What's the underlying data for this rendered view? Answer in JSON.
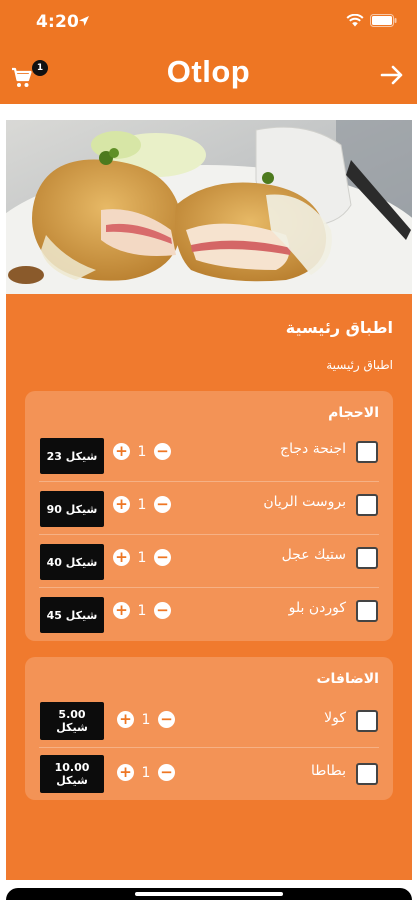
{
  "status_bar": {
    "time": "4:20"
  },
  "header": {
    "title": "Otlop",
    "cart_count": "1"
  },
  "hero": {
    "image": "cordon-bleu-chicken-photo"
  },
  "section": {
    "title": "اطباق رئيسية",
    "subtitle": "اطباق رئيسية"
  },
  "groups": [
    {
      "title": "الاحجام",
      "items": [
        {
          "name": "اجنحة دجاج",
          "qty": "1",
          "price": "23 شيكل"
        },
        {
          "name": "بروست الريان",
          "qty": "1",
          "price": "90 شيكل"
        },
        {
          "name": "ستيك عجل",
          "qty": "1",
          "price": "40 شيكل"
        },
        {
          "name": "كوردن بلو",
          "qty": "1",
          "price": "45 شيكل"
        }
      ]
    },
    {
      "title": "الاضافات",
      "items": [
        {
          "name": "كولا",
          "qty": "1",
          "price_amount": "5.00",
          "price_currency": "شيكل"
        },
        {
          "name": "بطاطا",
          "qty": "1",
          "price_amount": "10.00",
          "price_currency": "شيكل"
        }
      ]
    }
  ],
  "icons": {
    "cart": "cart-icon",
    "back": "arrow-right-icon",
    "wifi": "wifi-icon",
    "battery": "battery-icon",
    "location": "location-arrow-icon"
  },
  "colors": {
    "brand": "#EE7623",
    "card": "#F07A2E",
    "group_bg": "#F39356",
    "price_bg": "#0c0c0c"
  }
}
